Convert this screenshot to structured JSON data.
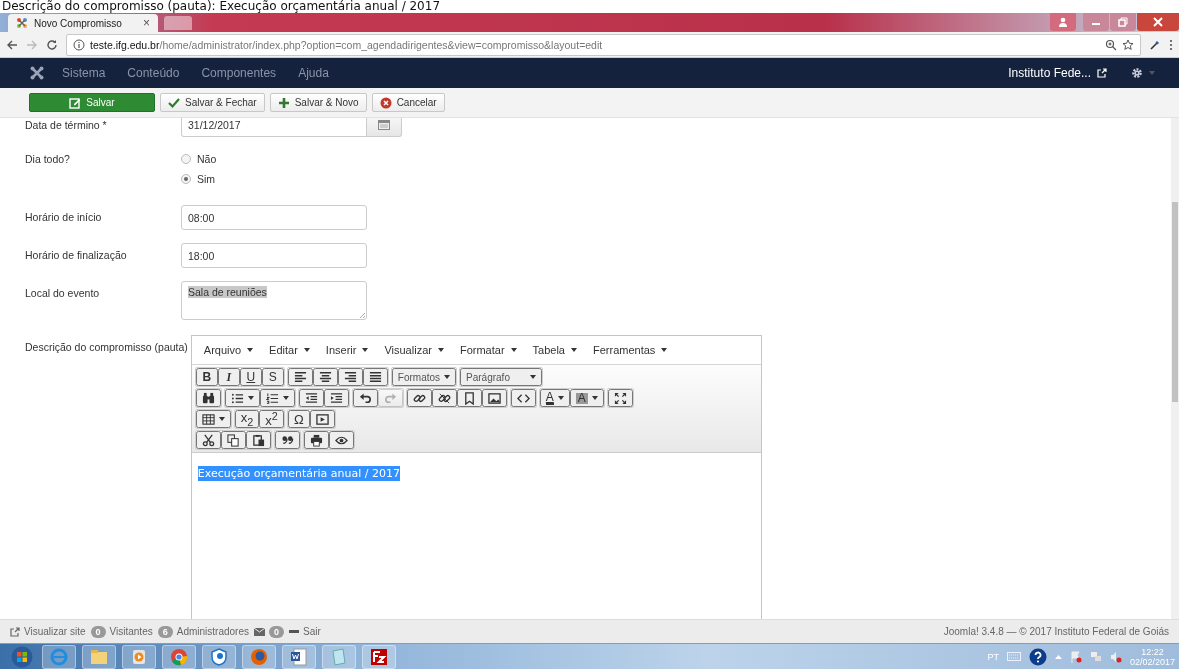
{
  "caption": "Descrição do compromisso (pauta): Execução orçamentária anual / 2017",
  "browser": {
    "tab": {
      "title": "Novo Compromisso",
      "close": "×"
    },
    "url": {
      "host": "teste.ifg.edu.br",
      "path": "/home/administrator/index.php?option=com_agendadirigentes&view=compromisso&layout=edit"
    }
  },
  "navbar": {
    "menu": [
      "Sistema",
      "Conteúdo",
      "Componentes",
      "Ajuda"
    ],
    "site_link": "Instituto Fede..."
  },
  "toolbar": [
    {
      "label": "Salvar",
      "kind": "primary"
    },
    {
      "label": "Salvar & Fechar",
      "kind": "check"
    },
    {
      "label": "Salvar & Novo",
      "kind": "plus"
    },
    {
      "label": "Cancelar",
      "kind": "cancel"
    }
  ],
  "form": [
    {
      "kind": "date",
      "label": "Data de término *",
      "value": "31/12/2017"
    },
    {
      "kind": "radio",
      "label": "Dia todo?",
      "options": [
        {
          "label": "Não",
          "selected": false
        },
        {
          "label": "Sim",
          "selected": true
        }
      ]
    },
    {
      "kind": "input",
      "label": "Horário de início",
      "value": "08:00"
    },
    {
      "kind": "input",
      "label": "Horário de finalização",
      "value": "18:00"
    },
    {
      "kind": "textarea",
      "label": "Local do evento",
      "value": "Sala de reuniões",
      "selected": true
    },
    {
      "kind": "editor",
      "label": "Descrição do compromisso (pauta)",
      "menu": [
        "Arquivo",
        "Editar",
        "Inserir",
        "Visualizar",
        "Formatar",
        "Tabela",
        "Ferramentas"
      ],
      "toolbar": [
        [
          [
            {
              "kind": "glyph",
              "label": "B"
            },
            {
              "kind": "glyph",
              "label": "I"
            },
            {
              "kind": "glyph",
              "label": "U"
            },
            {
              "kind": "glyph",
              "label": "S"
            }
          ],
          [
            {
              "kind": "icon"
            },
            {
              "kind": "icon"
            },
            {
              "kind": "icon"
            },
            {
              "kind": "icon"
            }
          ],
          [
            {
              "kind": "menu",
              "label": "Formatos"
            }
          ],
          [
            {
              "kind": "select",
              "label": "Parágrafo"
            }
          ]
        ],
        [
          [
            {
              "kind": "icon"
            }
          ],
          [
            {
              "kind": "icon",
              "dropdown": true
            },
            {
              "kind": "icon",
              "dropdown": true
            }
          ],
          [
            {
              "kind": "icon"
            },
            {
              "kind": "icon"
            }
          ],
          [
            {
              "kind": "icon",
              "disabled": false
            },
            {
              "kind": "icon",
              "disabled": true
            }
          ],
          [
            {
              "kind": "icon"
            },
            {
              "kind": "icon"
            },
            {
              "kind": "icon"
            },
            {
              "kind": "icon"
            }
          ],
          [
            {
              "kind": "icon"
            }
          ],
          [
            {
              "kind": "glyph",
              "label": "A",
              "dropdown": true
            },
            {
              "kind": "glyph",
              "label": "A",
              "dropdown": true
            }
          ],
          [
            {
              "kind": "icon"
            }
          ]
        ],
        [
          [
            {
              "kind": "icon",
              "dropdown": true
            }
          ],
          [
            {
              "kind": "glyph",
              "label": "x$_{2}$"
            },
            {
              "kind": "glyph",
              "label": "x$^{2}$"
            }
          ],
          [
            {
              "kind": "glyph",
              "label": "Ω"
            },
            {
              "kind": "icon"
            }
          ]
        ],
        [
          [
            {
              "kind": "icon"
            },
            {
              "kind": "icon"
            },
            {
              "kind": "icon"
            }
          ],
          [
            {
              "kind": "icon"
            }
          ],
          [
            {
              "kind": "icon"
            },
            {
              "kind": "icon"
            }
          ]
        ]
      ],
      "content": {
        "text": "Execução orçamentária anual / 2017",
        "selected": true
      }
    }
  ],
  "footer": {
    "items": [
      {
        "kind": "link",
        "label": "Visualizar site"
      },
      {
        "kind": "count",
        "count": "0",
        "label": "Visitantes"
      },
      {
        "kind": "count",
        "count": "6",
        "label": "Administradores"
      },
      {
        "kind": "mail",
        "count": "0"
      },
      {
        "kind": "logout",
        "label": "Sair"
      }
    ],
    "copyright": "Joomla! 3.4.8 — © 2017 Instituto Federal de Goiás"
  },
  "taskbar": {
    "language": "PT",
    "time": "12:22",
    "date": "02/02/2017"
  }
}
